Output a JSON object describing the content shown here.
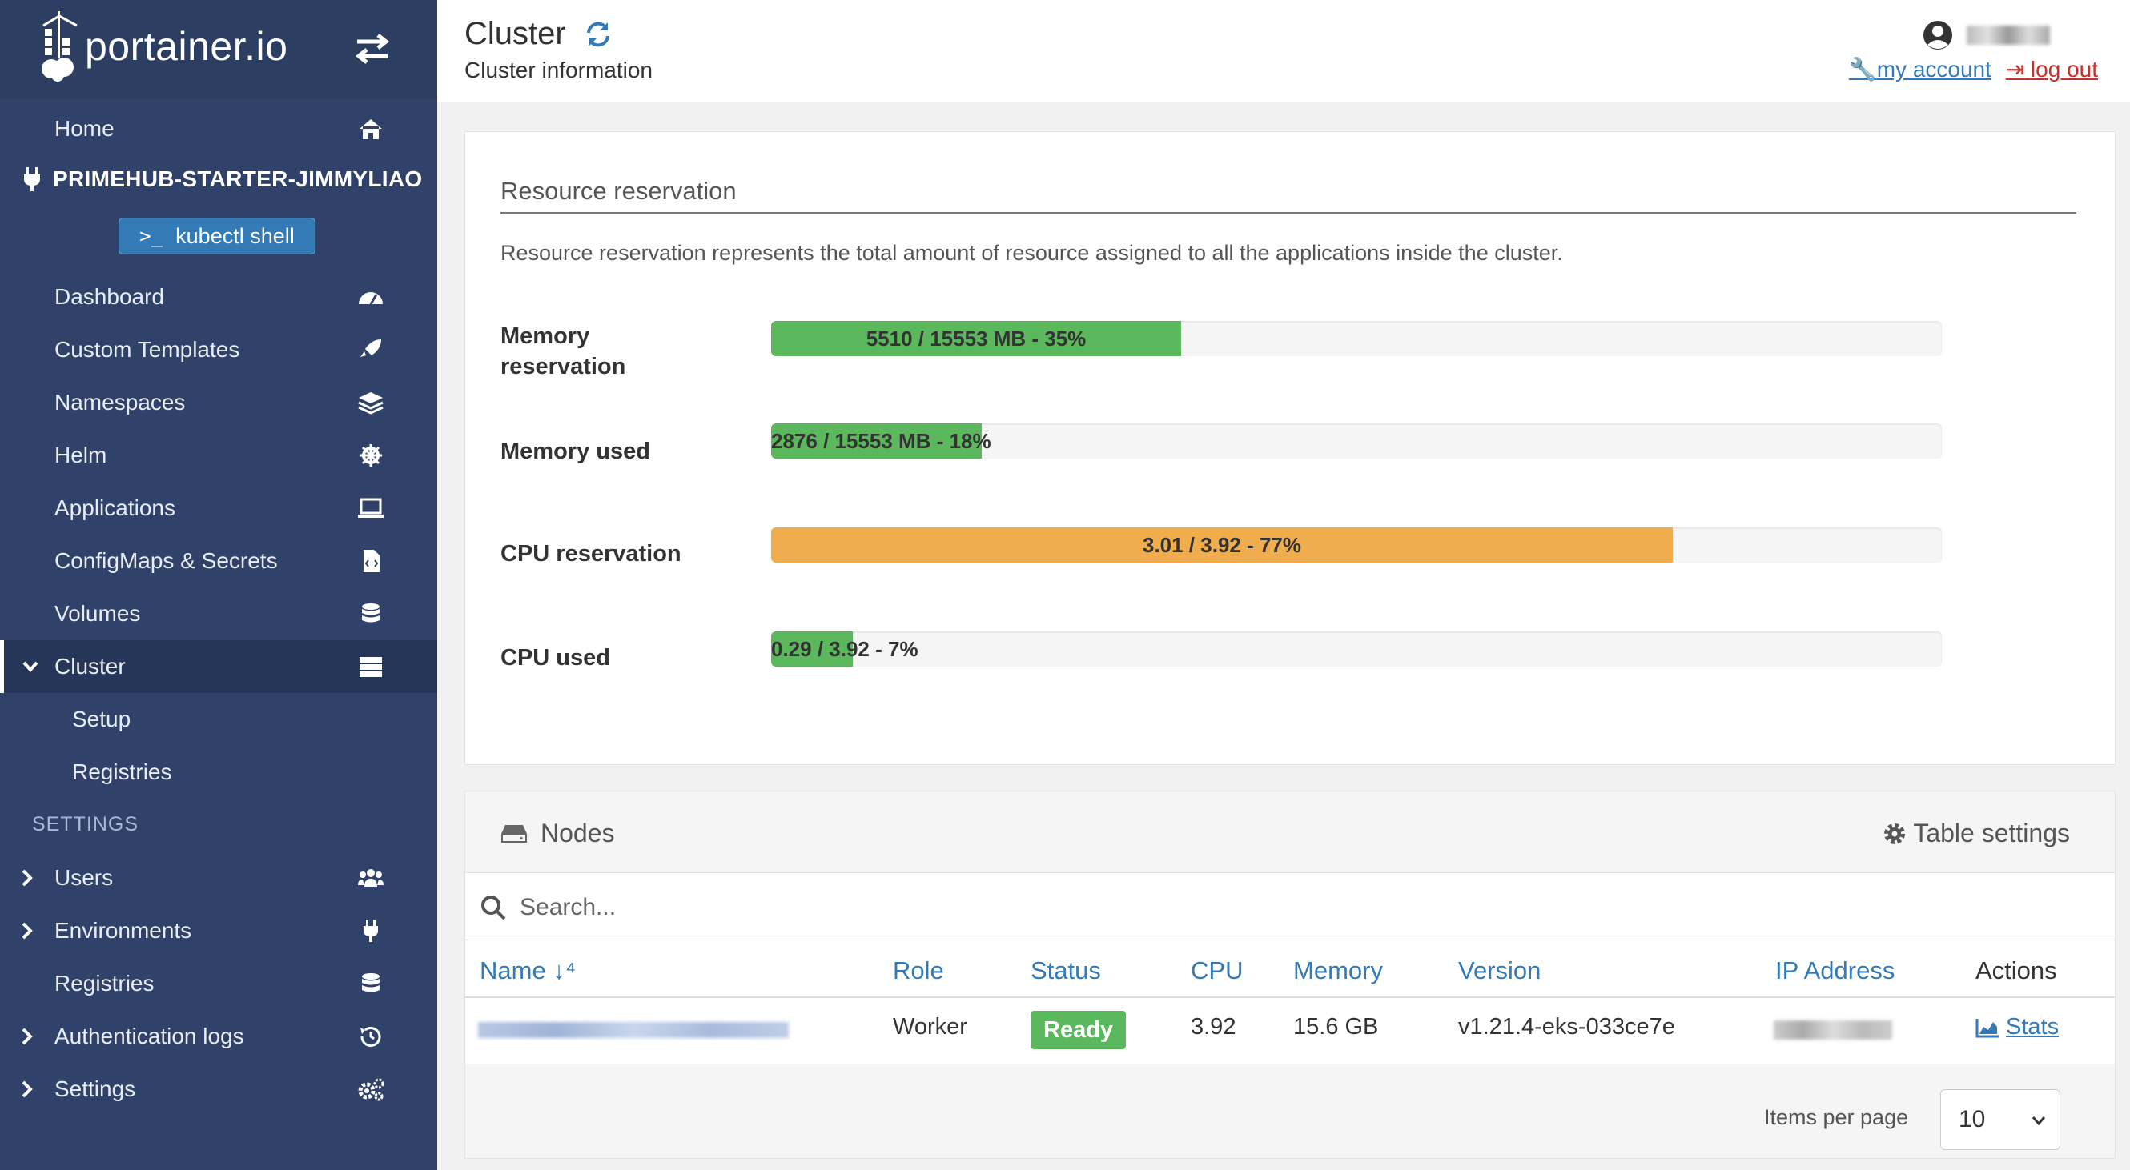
{
  "brand": {
    "logo_text": "portainer.io"
  },
  "sidebar": {
    "home": "Home",
    "environment_name": "PRIMEHUB-STARTER-JIMMYLIAO",
    "kubectl_label": "kubectl shell",
    "items": [
      {
        "label": "Dashboard",
        "icon": "tachometer-icon"
      },
      {
        "label": "Custom Templates",
        "icon": "rocket-icon"
      },
      {
        "label": "Namespaces",
        "icon": "layers-icon"
      },
      {
        "label": "Helm",
        "icon": "helm-icon"
      },
      {
        "label": "Applications",
        "icon": "laptop-code-icon"
      },
      {
        "label": "ConfigMaps & Secrets",
        "icon": "file-code-icon"
      },
      {
        "label": "Volumes",
        "icon": "database-icon"
      },
      {
        "label": "Cluster",
        "icon": "server-icon"
      }
    ],
    "cluster_sub": [
      "Setup",
      "Registries"
    ],
    "settings_header": "SETTINGS",
    "settings_items": [
      {
        "label": "Users",
        "icon": "users-icon"
      },
      {
        "label": "Environments",
        "icon": "plug-icon"
      },
      {
        "label": "Registries",
        "icon": "database-icon"
      },
      {
        "label": "Authentication logs",
        "icon": "history-icon"
      },
      {
        "label": "Settings",
        "icon": "cogs-icon"
      }
    ]
  },
  "header": {
    "title": "Cluster",
    "subtitle": "Cluster information",
    "my_account": "my account",
    "log_out": "log out"
  },
  "resources": {
    "title": "Resource reservation",
    "description": "Resource reservation represents the total amount of resource assigned to all the applications inside the cluster.",
    "rows": [
      {
        "label_line1": "Memory",
        "label_line2": "reservation",
        "text": "5510 / 15553 MB - 35%",
        "percent": 35,
        "color": "#5cb85c"
      },
      {
        "label": "Memory used",
        "text": "2876 / 15553 MB - 18%",
        "percent": 18,
        "color": "#5cb85c"
      },
      {
        "label": "CPU reservation",
        "text": "3.01 / 3.92 - 77%",
        "percent": 77,
        "color": "#f0ad4e"
      },
      {
        "label": "CPU used",
        "text": "0.29 / 3.92 - 7%",
        "percent": 7,
        "color": "#5cb85c"
      }
    ]
  },
  "nodes": {
    "title": "Nodes",
    "table_settings": "Table settings",
    "search_placeholder": "Search...",
    "columns": [
      "Name",
      "Role",
      "Status",
      "CPU",
      "Memory",
      "Version",
      "IP Address",
      "Actions"
    ],
    "rows": [
      {
        "role": "Worker",
        "status": "Ready",
        "cpu": "3.92",
        "memory": "15.6 GB",
        "version": "v1.21.4-eks-033ce7e",
        "action": "Stats"
      }
    ],
    "items_per_page_label": "Items per page",
    "items_per_page": "10"
  }
}
